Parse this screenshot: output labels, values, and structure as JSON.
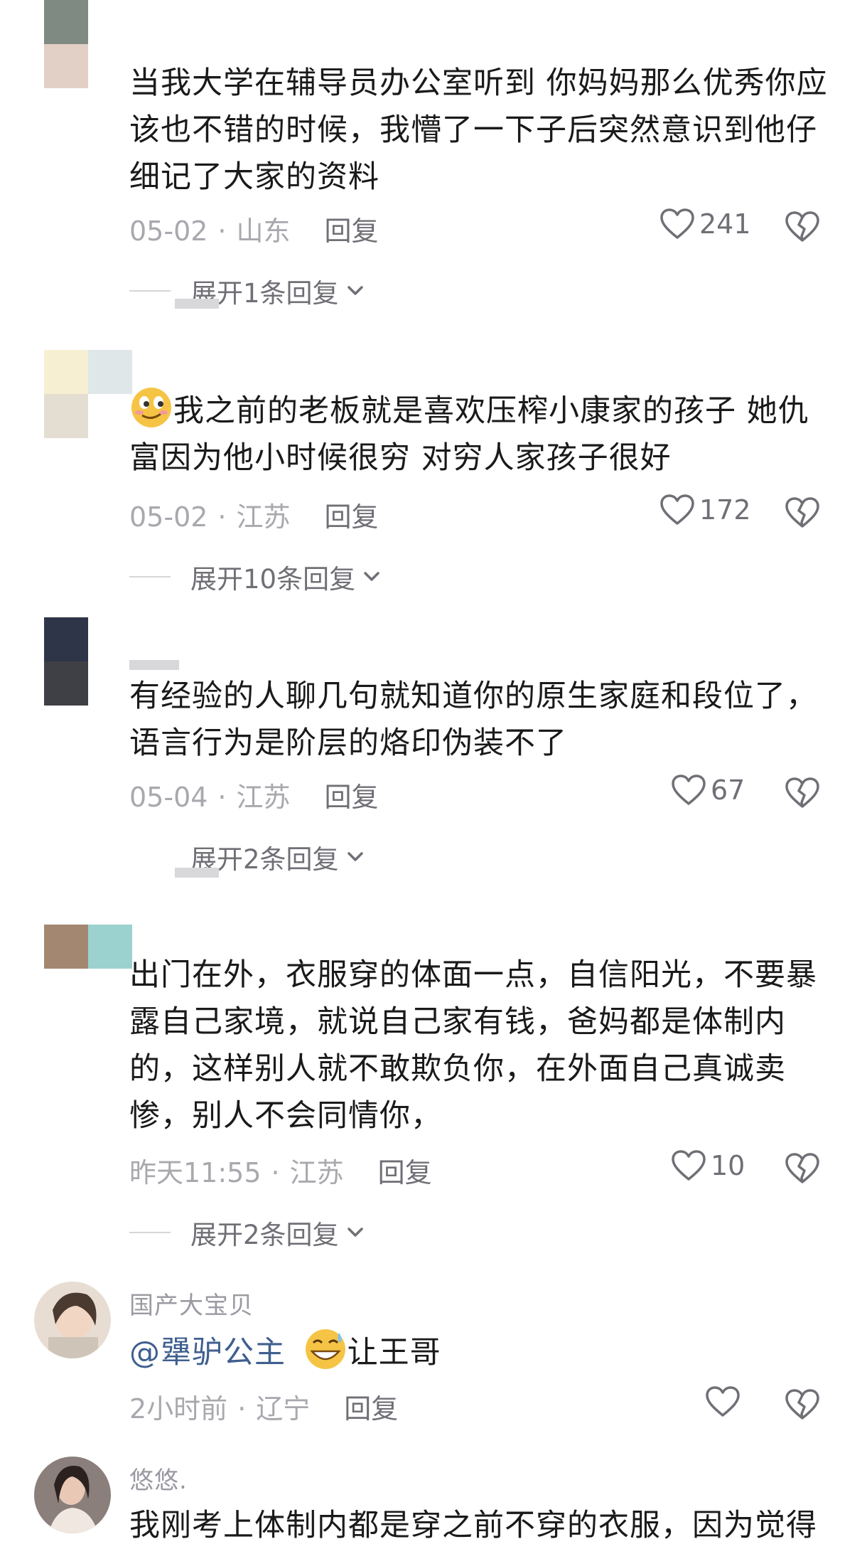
{
  "comments": [
    {
      "text": "当我大学在辅导员办公室听到   你妈妈那么优秀你应该也不错的时候，我懵了一下子后突然意识到他仔细记了大家的资料",
      "date": "05-02",
      "location": "山东",
      "reply_label": "回复",
      "likes": "241",
      "expand_label": "展开1条回复"
    },
    {
      "text_after_emoji": "我之前的老板就是喜欢压榨小康家的孩子 她仇富因为他小时候很穷 对穷人家孩子很好",
      "date": "05-02",
      "location": "江苏",
      "reply_label": "回复",
      "likes": "172",
      "expand_label": "展开10条回复"
    },
    {
      "text": "有经验的人聊几句就知道你的原生家庭和段位了，语言行为是阶层的烙印伪装不了",
      "date": "05-04",
      "location": "江苏",
      "reply_label": "回复",
      "likes": "67",
      "expand_label": "展开2条回复"
    },
    {
      "text": "出门在外，衣服穿的体面一点，自信阳光，不要暴露自己家境，就说自己家有钱，爸妈都是体制内的，这样别人就不敢欺负你，在外面自己真诚卖惨，别人不会同情你，",
      "date": "昨天11:55",
      "location": "江苏",
      "reply_label": "回复",
      "likes": "10",
      "expand_label": "展开2条回复"
    },
    {
      "username": "国产大宝贝",
      "mention": "@犟驴公主",
      "text_after_emoji": "让王哥",
      "date": "2小时前",
      "location": "辽宁",
      "reply_label": "回复"
    },
    {
      "username": "悠悠.",
      "text": "我刚考上体制内都是穿之前不穿的衣服，因为觉得"
    }
  ],
  "icons": {
    "like": "heart-outline-icon",
    "dislike": "broken-heart-icon",
    "expand": "chevron-down-icon"
  },
  "colors": {
    "meta_gray": "#a8a8ae",
    "action_gray": "#6f6f76",
    "mention_blue": "#3f5f8f"
  }
}
